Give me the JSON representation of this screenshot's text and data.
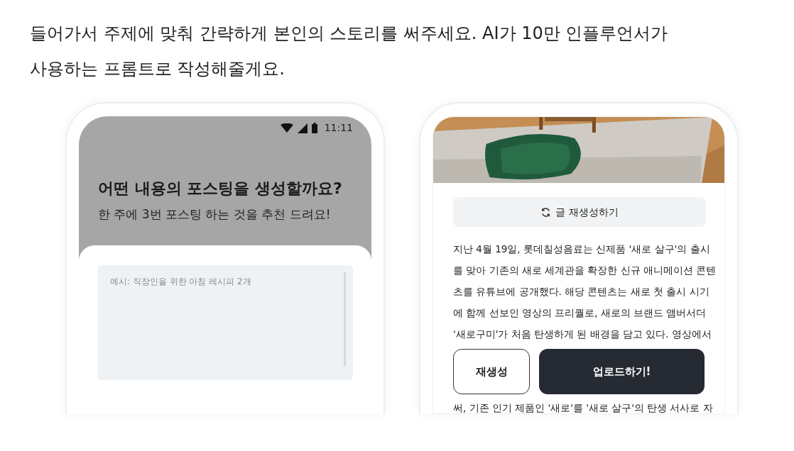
{
  "intro": "들어가서 주제에 맞춰 간략하게 본인의 스토리를 써주세요. AI가 10만 인플루언서가 사용하는 프롬트로 작성해줄게요.",
  "input_screen": {
    "status_bar": {
      "time": "11:11"
    },
    "title": "어떤 내용의 포스팅을 생성할까요?",
    "subtitle": "한 주에 3번 포스팅 하는 것을 추천 드려요!",
    "prompt_field": {
      "placeholder": "예시: 직장인을 위한 아침 레시피 2개"
    }
  },
  "result_screen": {
    "regenerate_text_button": "글 재생성하기",
    "article_lines": [
      "지난 4월 19일, 롯데칠성음료는 신제품 '새로 살구'의 출시",
      "를 맞아 기존의 새로 세계관을 확장한 신규 애니메이션 콘텐",
      "츠를 유튜브에 공개했다. 해당 콘텐츠는 새로 첫 출시 시기",
      "에 함께 선보인 영상의 프리퀄로, 새로의 브랜드 앰버서더",
      "'새로구미'가 처음 탄생하게 된 배경을 담고 있다. 영상에서"
    ],
    "buttons": [
      {
        "label": "재생성",
        "kind": "secondary"
      },
      {
        "label": "업로드하기!",
        "kind": "primary"
      }
    ],
    "article_tail": "써, 기존 인기 제품인 '새로'를 '새로 살구'의 탄생 서사로 자"
  }
}
